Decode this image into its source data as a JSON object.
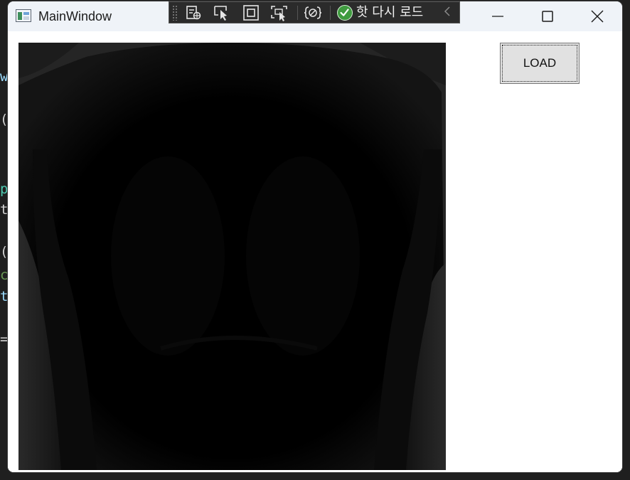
{
  "background_code": {
    "fragments": [
      {
        "text": "w",
        "color": "#9cdcfe"
      },
      {
        "text": "(",
        "color": "#d4d4d4"
      },
      {
        "text": "p",
        "color": "#4ec9b0"
      },
      {
        "text": "t,",
        "color": "#d4d4d4"
      },
      {
        "text": "(",
        "color": "#d4d4d4"
      },
      {
        "text": "c",
        "color": "#6a9955"
      },
      {
        "text": "th",
        "color": "#9cdcfe"
      },
      {
        "text": "=",
        "color": "#d4d4d4"
      }
    ]
  },
  "window": {
    "title": "MainWindow",
    "app_icon": "wpf-window-icon"
  },
  "debug_toolbar": {
    "buttons": [
      {
        "icon": "live-visual-tree-icon"
      },
      {
        "icon": "select-element-icon"
      },
      {
        "icon": "display-layout-adorners-icon"
      },
      {
        "icon": "track-focused-element-icon"
      },
      {
        "icon": "binding-failures-icon"
      }
    ],
    "hot_reload": {
      "icon": "check-circle-icon",
      "label": "핫 다시 로드"
    },
    "collapse_icon": "chevron-left-icon"
  },
  "window_controls": {
    "minimize": "minimize-icon",
    "maximize": "maximize-icon",
    "close": "close-icon"
  },
  "main": {
    "image": {
      "description_icon": "xray-image",
      "background": "#000000"
    },
    "load_button": {
      "label": "LOAD"
    }
  },
  "colors": {
    "titlebar": "#eff3f8",
    "toolbar": "#2b2b2b",
    "hot_reload_ok": "#3f9b3f",
    "button_face": "#e1e1e1"
  }
}
